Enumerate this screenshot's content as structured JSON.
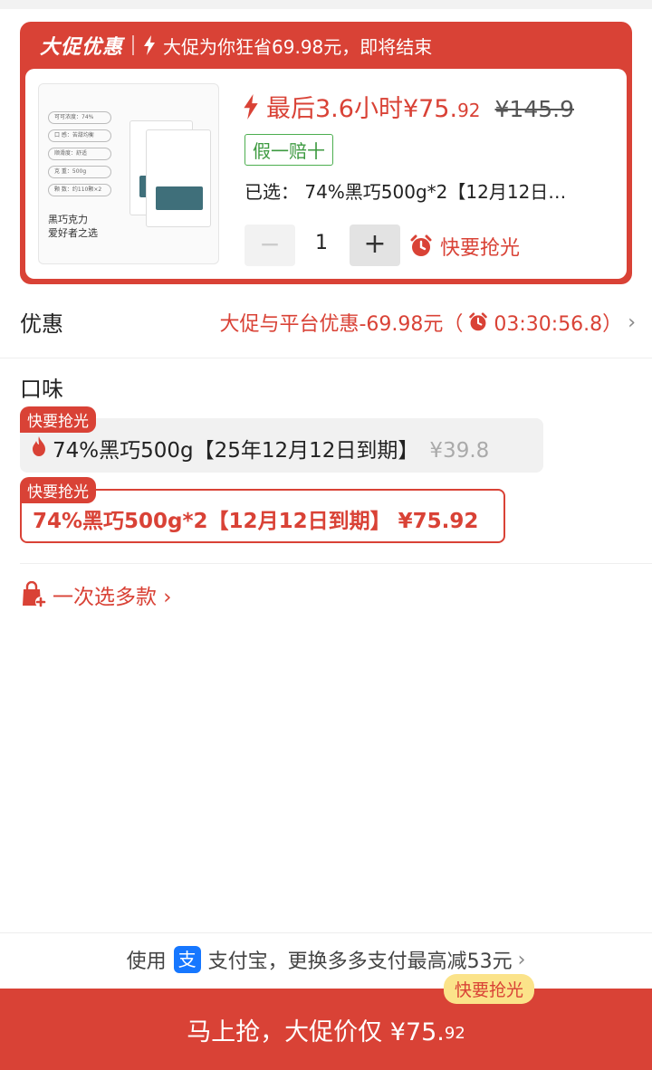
{
  "promo": {
    "brand": "大促优惠",
    "subtitle": "大促为你狂省69.98元，即将结束",
    "countdown_price": "最后3.6小时¥75.",
    "countdown_cents": "92",
    "original_price": "¥145.9",
    "guarantee": "假一赔十",
    "selected": "已选： 74%黑巧500g*2【12月12日…",
    "quantity": "1",
    "minus": "−",
    "plus": "+",
    "hurry": "快要抢光"
  },
  "product_image": {
    "specs": [
      "可可浓度：74%",
      "口 感：苦甜均衡",
      "顺滑度：舒适",
      "克 重：500g",
      "颗 数：约110颗×2"
    ],
    "caption_line1": "黑巧克力",
    "caption_line2": "爱好者之选"
  },
  "discount": {
    "label": "优惠",
    "text": "大促与平台优惠-69.98元（",
    "timer": "03:30:56.8）",
    "chevron": "›"
  },
  "flavor": {
    "label": "口味",
    "options": [
      {
        "tag": "快要抢光",
        "name": "74%黑巧500g【25年12月12日到期】",
        "price": "¥39.8"
      },
      {
        "tag": "快要抢光",
        "name": "74%黑巧500g*2【12月12日到期】 ¥75.92"
      }
    ],
    "multi": "一次选多款 ›"
  },
  "payment": {
    "prefix": "使用",
    "alipay_glyph": "支",
    "text": "支付宝，更换多多支付最高减53元",
    "chevron": "›"
  },
  "buy": {
    "text": "马上抢，大促价仅 ¥75.",
    "cents": "92",
    "tag": "快要抢光"
  },
  "colors": {
    "accent": "#d94236",
    "green": "#3d9a40",
    "alipay": "#1677ff",
    "tag_yellow": "#fbe38a"
  }
}
